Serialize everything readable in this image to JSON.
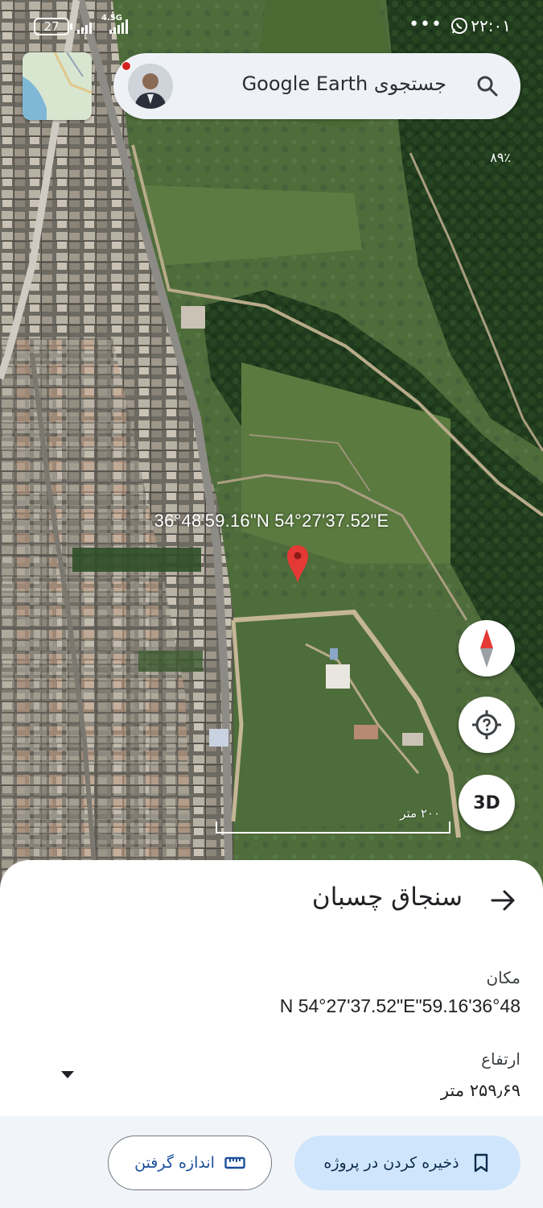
{
  "status_bar": {
    "battery": "27",
    "network": "4.5G",
    "time": "۲۲:۰۱",
    "overflow": "•••"
  },
  "search": {
    "placeholder": "جستجوی Google Earth"
  },
  "map": {
    "battery_percent_overlay": "۸۹٪",
    "coordinate_label": "36°48'59.16\"N 54°27'37.52\"E",
    "scale_label": "۲۰۰ متر",
    "three_d_label": "3D"
  },
  "sheet": {
    "title": "سنجاق چسبان",
    "location_label": "مکان",
    "location_value": "N 54°27'37.52\"E\"59.16'36°48",
    "altitude_label": "ارتفاع",
    "altitude_value": "۲۵۹٫۶۹ متر"
  },
  "actions": {
    "save_label": "ذخیره کردن در پروژه",
    "measure_label": "اندازه گرفتن"
  },
  "colors": {
    "pin": "#e53935",
    "save_button_bg": "#cfe5fb",
    "measure_text": "#1a4e9c"
  }
}
